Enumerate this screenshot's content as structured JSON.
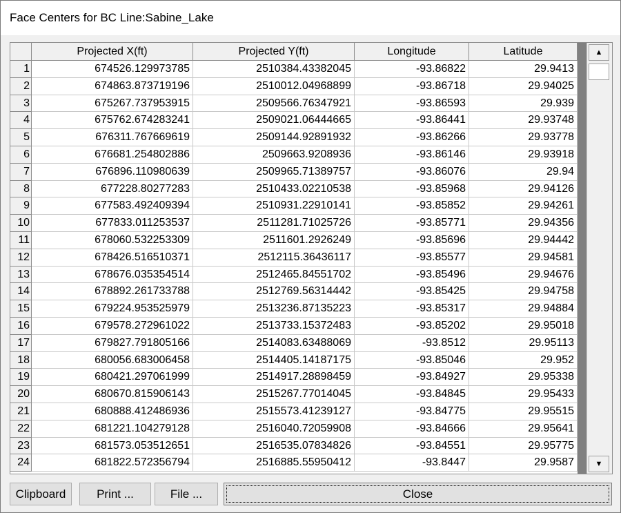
{
  "window": {
    "title": "Face Centers for BC Line:Sabine_Lake"
  },
  "table": {
    "headers": [
      "Projected X(ft)",
      "Projected Y(ft)",
      "Longitude",
      "Latitude"
    ],
    "rows": [
      [
        "1",
        "674526.129973785",
        "2510384.43382045",
        "-93.86822",
        "29.9413"
      ],
      [
        "2",
        "674863.873719196",
        "2510012.04968899",
        "-93.86718",
        "29.94025"
      ],
      [
        "3",
        "675267.737953915",
        "2509566.76347921",
        "-93.86593",
        "29.939"
      ],
      [
        "4",
        "675762.674283241",
        "2509021.06444665",
        "-93.86441",
        "29.93748"
      ],
      [
        "5",
        "676311.767669619",
        "2509144.92891932",
        "-93.86266",
        "29.93778"
      ],
      [
        "6",
        "676681.254802886",
        "2509663.9208936",
        "-93.86146",
        "29.93918"
      ],
      [
        "7",
        "676896.110980639",
        "2509965.71389757",
        "-93.86076",
        "29.94"
      ],
      [
        "8",
        "677228.80277283",
        "2510433.02210538",
        "-93.85968",
        "29.94126"
      ],
      [
        "9",
        "677583.492409394",
        "2510931.22910141",
        "-93.85852",
        "29.94261"
      ],
      [
        "10",
        "677833.011253537",
        "2511281.71025726",
        "-93.85771",
        "29.94356"
      ],
      [
        "11",
        "678060.532253309",
        "2511601.2926249",
        "-93.85696",
        "29.94442"
      ],
      [
        "12",
        "678426.516510371",
        "2512115.36436117",
        "-93.85577",
        "29.94581"
      ],
      [
        "13",
        "678676.035354514",
        "2512465.84551702",
        "-93.85496",
        "29.94676"
      ],
      [
        "14",
        "678892.261733788",
        "2512769.56314442",
        "-93.85425",
        "29.94758"
      ],
      [
        "15",
        "679224.953525979",
        "2513236.87135223",
        "-93.85317",
        "29.94884"
      ],
      [
        "16",
        "679578.272961022",
        "2513733.15372483",
        "-93.85202",
        "29.95018"
      ],
      [
        "17",
        "679827.791805166",
        "2514083.63488069",
        "-93.8512",
        "29.95113"
      ],
      [
        "18",
        "680056.683006458",
        "2514405.14187175",
        "-93.85046",
        "29.952"
      ],
      [
        "19",
        "680421.297061999",
        "2514917.28898459",
        "-93.84927",
        "29.95338"
      ],
      [
        "20",
        "680670.815906143",
        "2515267.77014045",
        "-93.84845",
        "29.95433"
      ],
      [
        "21",
        "680888.412486936",
        "2515573.41239127",
        "-93.84775",
        "29.95515"
      ],
      [
        "22",
        "681221.104279128",
        "2516040.72059908",
        "-93.84666",
        "29.95641"
      ],
      [
        "23",
        "681573.053512651",
        "2516535.07834826",
        "-93.84551",
        "29.95775"
      ],
      [
        "24",
        "681822.572356794",
        "2516885.55950412",
        "-93.8447",
        "29.9587"
      ]
    ]
  },
  "scrollbar": {
    "up_icon": "▲",
    "down_icon": "▼"
  },
  "buttons": {
    "clipboard": "Clipboard",
    "print": "Print ...",
    "file": "File ...",
    "close": "Close"
  }
}
